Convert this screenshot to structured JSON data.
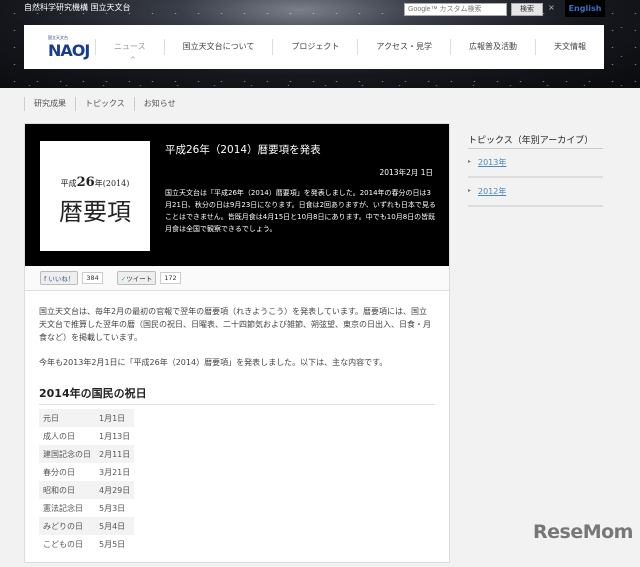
{
  "top": {
    "org": "自然科学研究機構 国立天文台",
    "search_placeholder": "Google™ カスタム検索",
    "search_button": "検索",
    "close": "×",
    "english": "English"
  },
  "nav": {
    "logo_small": "国立天文台",
    "logo": "NAOJ",
    "items": [
      "ニュース",
      "国立天文台について",
      "プロジェクト",
      "アクセス・見学",
      "広報普及活動",
      "天文情報"
    ]
  },
  "subnav": [
    "研究成果",
    "トピックス",
    "お知らせ"
  ],
  "article": {
    "image_line1_a": "平成",
    "image_line1_b": "26",
    "image_line1_c": "年(2014)",
    "image_line2": "暦要項",
    "title": "平成26年（2014）暦要項を発表",
    "date": "2013年2月 1日",
    "lead": "国立天文台は「平成26年（2014）暦要項」を発表しました。2014年の春分の日は3月21日、秋分の日は9月23日になります。日食は2回ありますが、いずれも日本で見ることはできません。皆既月食は4月15日と10月8日にあります。中でも10月8日の皆既月食は全国で観察できるでしょう。",
    "like": "いいね！",
    "like_count": "384",
    "tweet": "ツイート",
    "tweet_count": "172",
    "p1": "国立天文台は、毎年2月の最初の官報で翌年の暦要項（れきようこう）を発表しています。暦要項には、国立天文台で推算した翌年の暦（国民の祝日、日曜表、二十四節気および雑節、朔弦望、東京の日出入、日食・月食など）を掲載しています。",
    "p2": "今年も2013年2月1日に「平成26年（2014）暦要項」を発表しました。以下は、主な内容です。",
    "holidays_title": "2014年の国民の祝日",
    "holidays": [
      [
        "元日",
        "1月1日"
      ],
      [
        "成人の日",
        "1月13日"
      ],
      [
        "建国記念の日",
        "2月11日"
      ],
      [
        "春分の日",
        "3月21日"
      ],
      [
        "昭和の日",
        "4月29日"
      ],
      [
        "憲法記念日",
        "5月3日"
      ],
      [
        "みどりの日",
        "5月4日"
      ],
      [
        "こどもの日",
        "5月5日"
      ]
    ]
  },
  "sidebar": {
    "title": "トピックス（年別アーカイブ）",
    "links": [
      "2013年",
      "2012年"
    ]
  },
  "watermark": "ReseMom"
}
